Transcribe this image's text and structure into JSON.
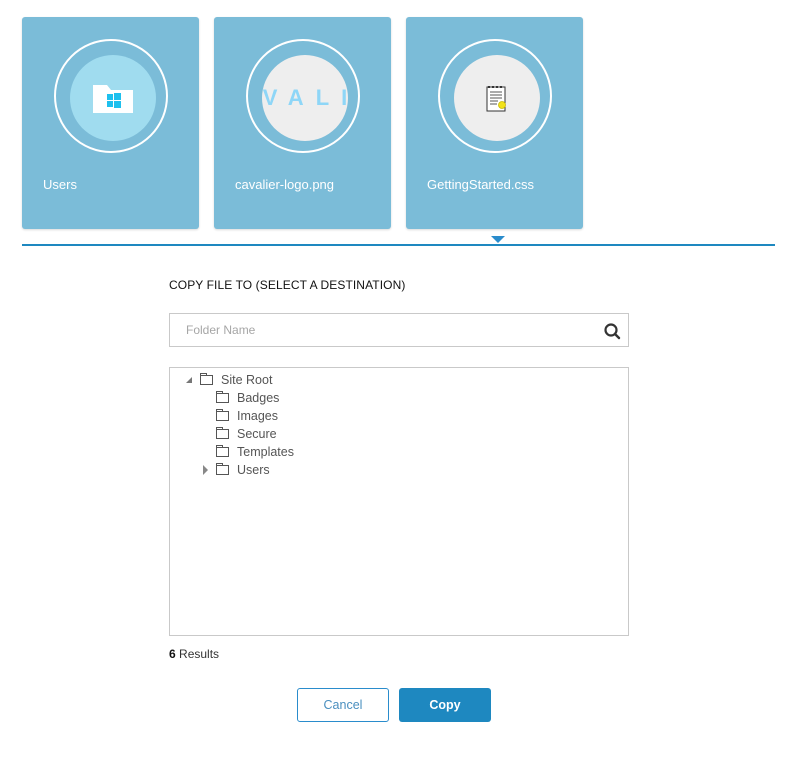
{
  "cards": [
    {
      "name": "Users",
      "icon": "windows-folder-icon",
      "selected": false
    },
    {
      "name": "cavalier-logo.png",
      "icon": "image-thumbnail",
      "thumbnail_text": "VALI",
      "selected": false
    },
    {
      "name": "GettingStarted.css",
      "icon": "certificate-document-icon",
      "selected": true
    }
  ],
  "dialog": {
    "heading": "COPY FILE TO (SELECT A DESTINATION)",
    "search": {
      "placeholder": "Folder Name",
      "value": ""
    },
    "tree": [
      {
        "label": "Site Root",
        "level": 0,
        "expanded": true,
        "has_children": true
      },
      {
        "label": "Badges",
        "level": 1,
        "has_children": false
      },
      {
        "label": "Images",
        "level": 1,
        "has_children": false
      },
      {
        "label": "Secure",
        "level": 1,
        "has_children": false
      },
      {
        "label": "Templates",
        "level": 1,
        "has_children": false
      },
      {
        "label": "Users",
        "level": 1,
        "expanded": false,
        "has_children": true
      }
    ],
    "results_count": "6",
    "results_label": " Results",
    "cancel_label": "Cancel",
    "copy_label": "Copy"
  },
  "colors": {
    "card_bg": "#7bbcd8",
    "accent": "#1e88c0",
    "logo_text": "#8ed6f7",
    "windows_blue": "#1ec0ee"
  }
}
